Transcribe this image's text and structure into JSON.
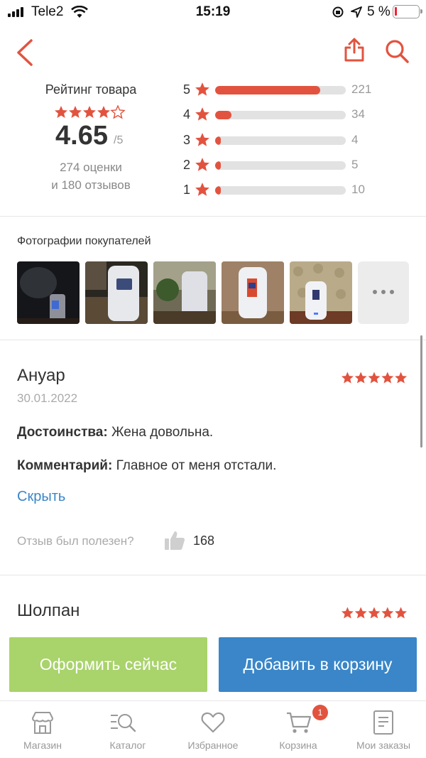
{
  "status_bar": {
    "carrier": "Tele2",
    "time": "15:19",
    "battery": "5 %"
  },
  "rating": {
    "title": "Рейтинг товара",
    "score": "4.65",
    "score_max": "/5",
    "count_ratings": "274 оценки",
    "count_reviews": "и 180 отзывов",
    "distribution": [
      {
        "stars": "5",
        "count": "221",
        "fraction": 0.806
      },
      {
        "stars": "4",
        "count": "34",
        "fraction": 0.124
      },
      {
        "stars": "3",
        "count": "4",
        "fraction": 0.015
      },
      {
        "stars": "2",
        "count": "5",
        "fraction": 0.018
      },
      {
        "stars": "1",
        "count": "10",
        "fraction": 0.036
      }
    ]
  },
  "photos": {
    "title": "Фотографии покупателей"
  },
  "reviews": [
    {
      "name": "Ануар",
      "date": "30.01.2022",
      "pros_label": "Достоинства:",
      "pros": "Жена довольна.",
      "comment_label": "Комментарий:",
      "comment": "Главное от меня отстали.",
      "hide": "Скрыть",
      "helpful_question": "Отзыв был полезен?",
      "likes": "168",
      "stars": 5
    },
    {
      "name": "Шолпан",
      "stars": 5
    }
  ],
  "actions": {
    "buy_now": "Оформить сейчас",
    "add_to_cart": "Добавить в корзину"
  },
  "tabbar": {
    "items": [
      {
        "label": "Магазин",
        "icon": "store-icon"
      },
      {
        "label": "Каталог",
        "icon": "catalog-search-icon"
      },
      {
        "label": "Избранное",
        "icon": "heart-icon"
      },
      {
        "label": "Корзина",
        "icon": "cart-icon"
      },
      {
        "label": "Мои заказы",
        "icon": "orders-icon"
      }
    ],
    "cart_badge": "1"
  },
  "colors": {
    "accent": "#e2533f",
    "buy_now": "#a9d36b",
    "add_to_cart": "#3a86c8"
  }
}
